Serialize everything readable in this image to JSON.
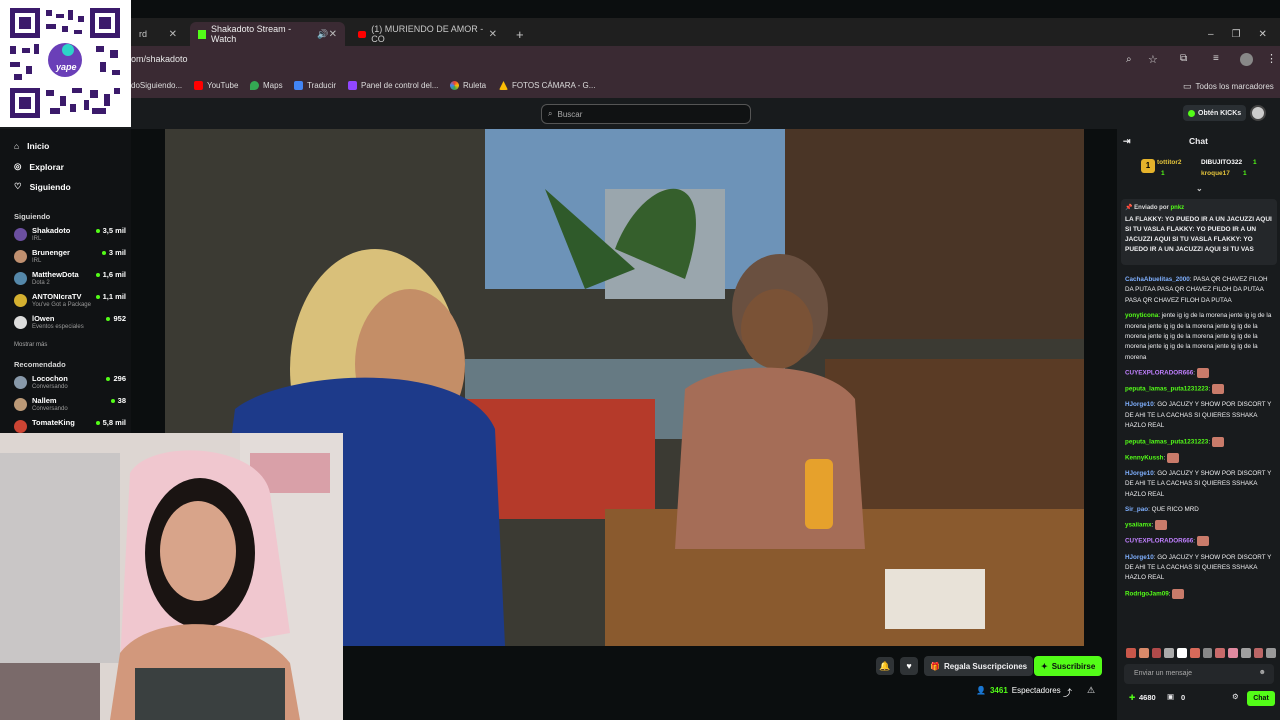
{
  "browser": {
    "tabs": [
      {
        "label": "rd"
      },
      {
        "label": "Shakadoto Stream - Watch"
      },
      {
        "label": "(1) MURIENDO DE AMOR - CO"
      }
    ],
    "new_tab": "+",
    "url": "om/shakadoto",
    "bookmarks": [
      "doSiguiendo...",
      "YouTube",
      "Maps",
      "Traducir",
      "Panel de control del...",
      "Ruleta",
      "FOTOS CÁMARA - G..."
    ],
    "all_bookmarks": "Todos los marcadores"
  },
  "overlay": {
    "qr_brand": "yape"
  },
  "header": {
    "search_placeholder": "Buscar",
    "get_kicks": "Obtén KICKs"
  },
  "sidebar": {
    "nav": [
      "Inicio",
      "Explorar",
      "Siguiendo"
    ],
    "following_title": "Siguiendo",
    "following": [
      {
        "name": "Shakadoto",
        "sub": "IRL",
        "viewers": "3,5 mil",
        "color": "#6b4fa0"
      },
      {
        "name": "Brunenger",
        "sub": "IRL",
        "viewers": "3 mil",
        "color": "#c09070"
      },
      {
        "name": "MatthewDota",
        "sub": "Dota 2",
        "viewers": "1,6 mil",
        "color": "#5588aa"
      },
      {
        "name": "ANTONIcraTV",
        "sub": "You've Got a Package",
        "viewers": "1,1 mil",
        "color": "#d4b030"
      },
      {
        "name": "lOwen",
        "sub": "Eventos especiales",
        "viewers": "952",
        "color": "#dddddd"
      }
    ],
    "show_more": "Mostrar más",
    "recommended_title": "Recomendado",
    "recommended": [
      {
        "name": "Locochon",
        "sub": "Conversando",
        "viewers": "296",
        "color": "#8899aa"
      },
      {
        "name": "Nallem",
        "sub": "Conversando",
        "viewers": "38",
        "color": "#bb9977"
      },
      {
        "name": "TomateKing",
        "sub": "",
        "viewers": "5,8 mil",
        "color": "#cc4433"
      }
    ]
  },
  "player": {
    "gift_label": "Regala Suscripciones",
    "subscribe_label": "Suscribirse",
    "viewers_count": "3461",
    "viewers_label": "Espectadores"
  },
  "chat": {
    "title": "Chat",
    "gifters": [
      {
        "name": "tottitor2",
        "count": "1"
      },
      {
        "name": "DIBUJITO322",
        "count": "1"
      },
      {
        "name": "kroque17",
        "count": "1"
      }
    ],
    "pinned_sender_prefix": "Enviado por",
    "pinned_sender": "pnkz",
    "pinned_text": "LA FLAKKY: YO PUEDO IR A UN JACUZZI AQUI SI TU VASLA FLAKKY: YO PUEDO IR A UN JACUZZI AQUI SI TU VASLA FLAKKY: YO PUEDO IR A UN JACUZZI AQUI SI TU VAS",
    "messages": [
      {
        "user": "CachaAbuelitas_2000",
        "color": "#7fb0ff",
        "text": "PASA QR CHAVEZ FILOH DA PUTAA  PASA QR CHAVEZ FILOH DA PUTAA  PASA QR CHAVEZ FILOH DA PUTAA"
      },
      {
        "user": "yonyticona",
        "color": "#53fc18",
        "text": "jente ig ig de la morena jente ig ig de la morena jente ig ig de la morena jente ig ig de la morena jente ig ig de la morena jente ig ig de la morena jente ig ig de la morena jente ig ig de la morena"
      },
      {
        "user": "CUYEXPLORADOR666",
        "color": "#c080ff",
        "text": ""
      },
      {
        "user": "peputa_lamas_puta1231223",
        "color": "#53fc18",
        "text": ""
      },
      {
        "user": "HJorge10",
        "color": "#7fb0ff",
        "text": "GO JACUZY Y SHOW POR DISCORT Y DE AHI TE LA CACHAS SI QUIERES SSHAKA HAZLO REAL"
      },
      {
        "user": "peputa_lamas_puta1231223",
        "color": "#53fc18",
        "text": ""
      },
      {
        "user": "KennyKussh",
        "color": "#53fc18",
        "text": ""
      },
      {
        "user": "HJorge10",
        "color": "#7fb0ff",
        "text": "GO JACUZY Y SHOW POR DISCORT Y DE AHI TE LA CACHAS SI QUIERES SSHAKA HAZLO REAL"
      },
      {
        "user": "Sir_pao",
        "color": "#7fb0ff",
        "text": "QUE RICO MRD"
      },
      {
        "user": "ysaiiamx",
        "color": "#53fc18",
        "text": ""
      },
      {
        "user": "CUYEXPLORADOR666",
        "color": "#c080ff",
        "text": ""
      },
      {
        "user": "HJorge10",
        "color": "#7fb0ff",
        "text": "GO JACUZY Y SHOW POR DISCORT Y DE AHI TE LA CACHAS SI QUIERES SSHAKA HAZLO REAL"
      },
      {
        "user": "RodrigoJam09",
        "color": "#53fc18",
        "text": ""
      }
    ],
    "input_placeholder": "Enviar un mensaje",
    "kicks_balance": "4680",
    "points": "0",
    "send_label": "Chat"
  },
  "colors": {
    "brand": "#53fc18",
    "bg": "#0b0e0f",
    "panel": "#181b1d"
  }
}
